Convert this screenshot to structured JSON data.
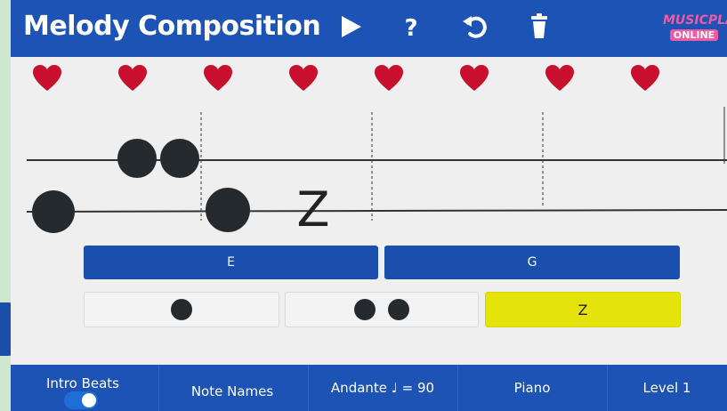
{
  "app": {
    "title": "Melody Composition",
    "logo_line1": "MUSICPLAY",
    "logo_line2": "ONLINE"
  },
  "toolbar": {
    "play_icon": "play-icon",
    "help_icon": "question-icon",
    "undo_icon": "undo-icon",
    "delete_icon": "trash-icon"
  },
  "hearts": {
    "count": 8,
    "color": "#c8102e"
  },
  "staff": {
    "measures": 4,
    "rest_symbol": "Z"
  },
  "pitch_buttons": [
    {
      "label": "E"
    },
    {
      "label": "G"
    }
  ],
  "rhythm_buttons": [
    {
      "name": "quarter-note",
      "dots": 1,
      "label": ""
    },
    {
      "name": "eighth-pair",
      "dots": 2,
      "label": ""
    },
    {
      "name": "rest",
      "dots": 0,
      "label": "Z",
      "selected": true
    }
  ],
  "footer": {
    "intro_beats": "Intro Beats",
    "intro_beats_on": true,
    "note_names": "Note Names",
    "tempo": "Andante ♩ = 90",
    "instrument": "Piano",
    "level": "Level 1"
  },
  "colors": {
    "header": "#1c53b4",
    "pitch_button": "#1a4fae",
    "selected_rhythm": "#e4e40c",
    "note": "#252a2e"
  }
}
